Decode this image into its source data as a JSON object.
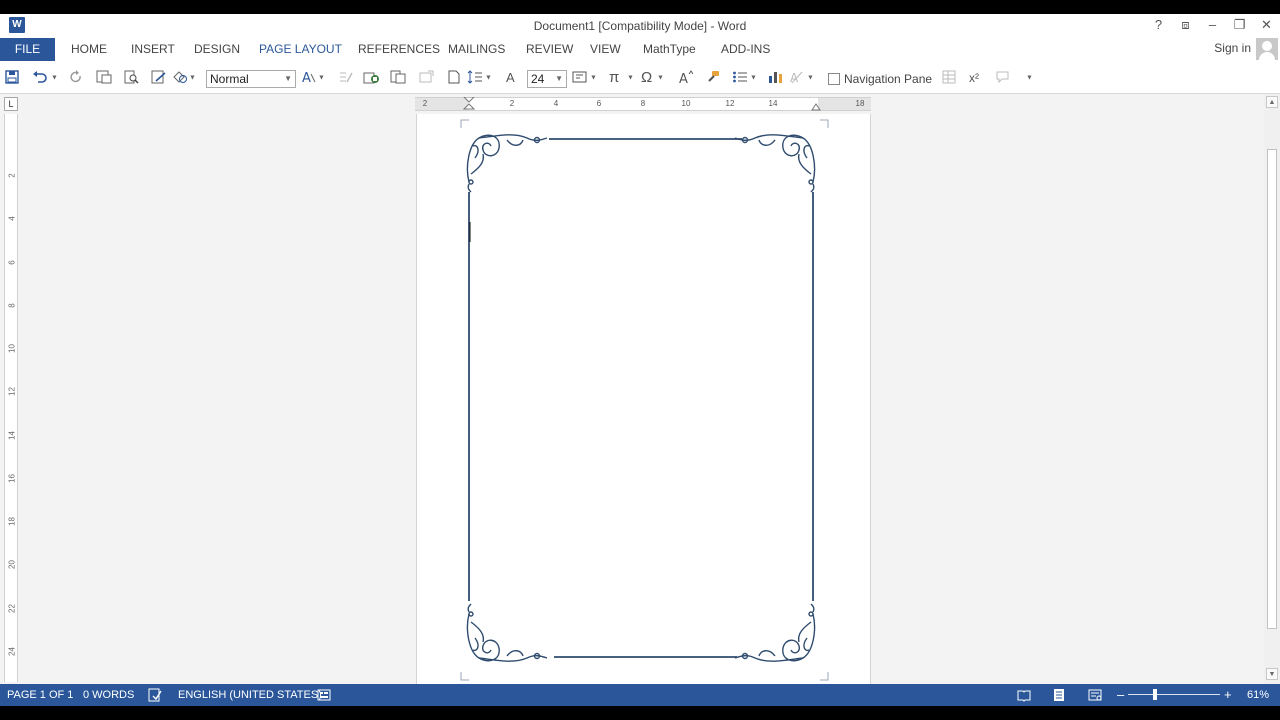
{
  "window": {
    "app_icon_letter": "W",
    "title": "Document1 [Compatibility Mode] - Word",
    "help": "?",
    "ribbon_display": "⧈",
    "minimize": "–",
    "restore": "❐",
    "close": "✕"
  },
  "tabs": [
    {
      "label": "FILE"
    },
    {
      "label": "HOME"
    },
    {
      "label": "INSERT"
    },
    {
      "label": "DESIGN"
    },
    {
      "label": "PAGE LAYOUT"
    },
    {
      "label": "REFERENCES"
    },
    {
      "label": "MAILINGS"
    },
    {
      "label": "REVIEW"
    },
    {
      "label": "VIEW"
    },
    {
      "label": "MathType"
    },
    {
      "label": "ADD-INS"
    }
  ],
  "active_tab": "PAGE LAYOUT",
  "account": {
    "signin_label": "Sign in"
  },
  "toolbar": {
    "style_value": "Normal",
    "font_size_value": "24",
    "navigation_pane_label": "Navigation Pane",
    "navigation_pane_checked": false,
    "font_glyph": "A",
    "pi_glyph": "π",
    "omega_glyph": "Ω",
    "superscript_glyph": "x²"
  },
  "rulers": {
    "tab_selector": "L",
    "horizontal_ticks": [
      "2",
      "2",
      "4",
      "6",
      "8",
      "10",
      "12",
      "14",
      "18"
    ],
    "vertical_ticks": [
      "2",
      "4",
      "6",
      "8",
      "10",
      "12",
      "14",
      "16",
      "18",
      "20",
      "22",
      "24"
    ]
  },
  "status": {
    "page": "PAGE 1 OF 1",
    "words": "0 WORDS",
    "language": "ENGLISH (UNITED STATES)",
    "zoom_minus": "–",
    "zoom_plus": "+",
    "zoom_level": "61%"
  },
  "colors": {
    "accent": "#2b579a",
    "page_border": "#2f4b6e"
  }
}
